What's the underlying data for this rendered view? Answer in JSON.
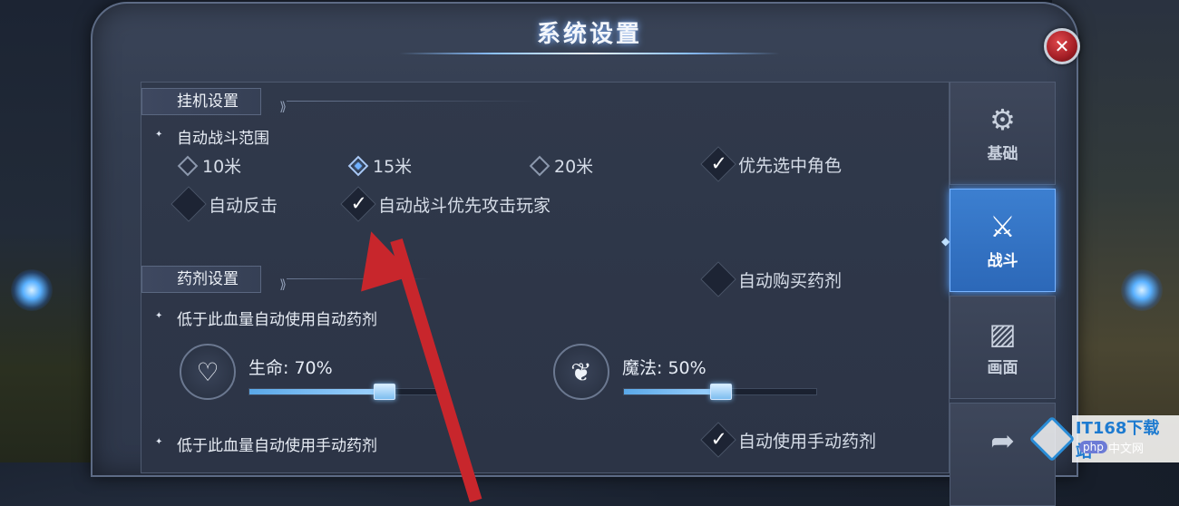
{
  "dialog": {
    "title": "系统设置",
    "close_label": "✕"
  },
  "afk": {
    "section_title": "挂机设置",
    "range_label": "自动战斗范围",
    "range_options": [
      "10米",
      "15米",
      "20米"
    ],
    "range_selected": "15米",
    "prefer_selected_role": "优先选中角色",
    "prefer_selected_role_checked": true,
    "auto_counter": "自动反击",
    "auto_counter_checked": false,
    "attack_players_first": "自动战斗优先攻击玩家",
    "attack_players_first_checked": true
  },
  "potion": {
    "section_title": "药剂设置",
    "auto_buy": "自动购买药剂",
    "auto_buy_checked": false,
    "auto_use_label": "低于此血量自动使用自动药剂",
    "hp_label": "生命: 70%",
    "hp_value": 70,
    "mp_label": "魔法: 50%",
    "mp_value": 50,
    "manual_use_label": "低于此血量自动使用手动药剂",
    "auto_manual_potion": "自动使用手动药剂",
    "auto_manual_potion_checked": true
  },
  "tabs": [
    {
      "label": "基础",
      "icon": "gear-icon",
      "active": false
    },
    {
      "label": "战斗",
      "icon": "sword-shield-icon",
      "active": true
    },
    {
      "label": "画面",
      "icon": "picture-icon",
      "active": false
    },
    {
      "label": "",
      "icon": "share-icon",
      "active": false
    }
  ],
  "watermark": {
    "brand": "IT168下载站",
    "php": "php",
    "cn": "中文网"
  },
  "colors": {
    "accent": "#3c7fd0",
    "arrow": "#c8262c",
    "slider_fill": "#5aa8e8"
  }
}
